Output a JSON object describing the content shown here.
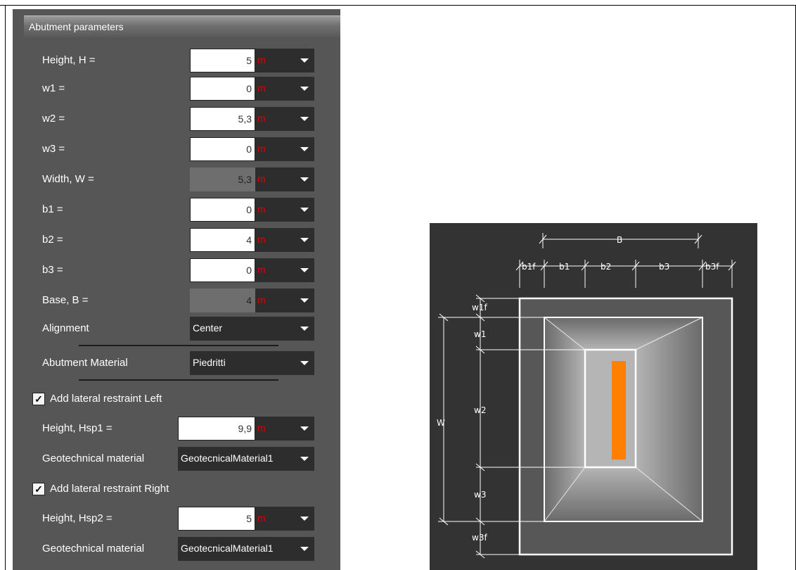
{
  "panel": {
    "title": "Abutment parameters",
    "rows": [
      {
        "label": "Height, H =",
        "value": "5",
        "unit": "m",
        "disabled": false
      },
      {
        "label": "w1 =",
        "value": "0",
        "unit": "m",
        "disabled": false
      },
      {
        "label": "w2 =",
        "value": "5,3",
        "unit": "m",
        "disabled": false
      },
      {
        "label": "w3 =",
        "value": "0",
        "unit": "m",
        "disabled": false
      },
      {
        "label": "Width, W =",
        "value": "5,3",
        "unit": "m",
        "disabled": true
      },
      {
        "label": "b1 =",
        "value": "0",
        "unit": "m",
        "disabled": false
      },
      {
        "label": "b2 =",
        "value": "4",
        "unit": "m",
        "disabled": false
      },
      {
        "label": "b3 =",
        "value": "0",
        "unit": "m",
        "disabled": false
      },
      {
        "label": "Base, B =",
        "value": "4",
        "unit": "m",
        "disabled": true
      }
    ],
    "alignment": {
      "label": "Alignment",
      "value": "Center"
    },
    "material": {
      "label": "Abutment Material",
      "value": "Piedritti"
    },
    "left_restraint": {
      "checkbox_label": "Add lateral restraint Left",
      "checked": true,
      "height_label": "Height, Hsp1 =",
      "height_value": "9,9",
      "height_unit": "m",
      "geo_label": "Geotechnical material",
      "geo_value": "GeotecnicalMaterial1"
    },
    "right_restraint": {
      "checkbox_label": "Add lateral restraint Right",
      "checked": true,
      "height_label": "Height, Hsp2 =",
      "height_value": "5",
      "height_unit": "m",
      "geo_label": "Geotechnical material",
      "geo_value": "GeotecnicalMaterial1"
    }
  },
  "diagram": {
    "labels": {
      "B": "B",
      "b1f": "b1f",
      "b1": "b1",
      "b2": "b2",
      "b3": "b3",
      "b3f": "b3f",
      "W": "W",
      "w1f": "w1f",
      "w1": "w1",
      "w2": "w2",
      "w3": "w3",
      "w3f": "w3f"
    },
    "colors": {
      "background": "#333333",
      "accent": "#ff7f00",
      "outline": "#ffffff"
    }
  }
}
